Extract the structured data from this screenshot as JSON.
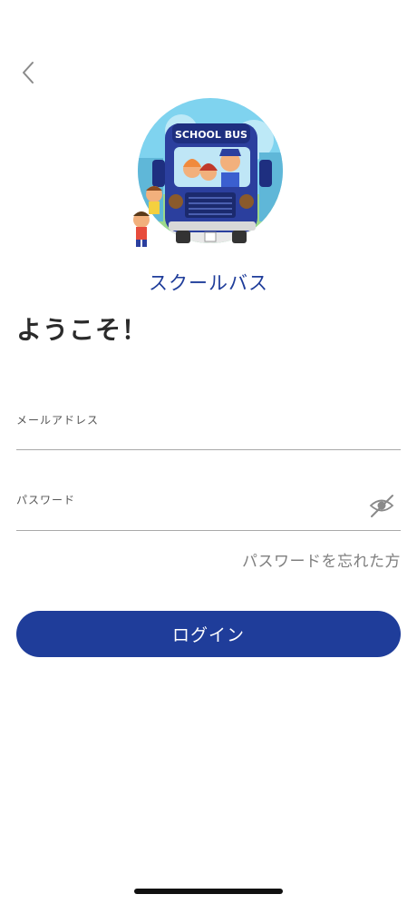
{
  "app": {
    "name": "スクールバス",
    "logo_text": "SCHOOL BUS"
  },
  "icons": {
    "back": "chevron-left-icon",
    "password_toggle": "eye-slash-icon"
  },
  "welcome_title": "ようこそ！",
  "email_field": {
    "label": "メールアドレス",
    "value": ""
  },
  "password_field": {
    "label": "パスワード",
    "value": ""
  },
  "forgot_password_label": "パスワードを忘れた方",
  "login_button_label": "ログイン",
  "colors": {
    "primary": "#1f3d9a",
    "divider": "#a9a9a9",
    "muted_text": "#7f7f7f"
  }
}
